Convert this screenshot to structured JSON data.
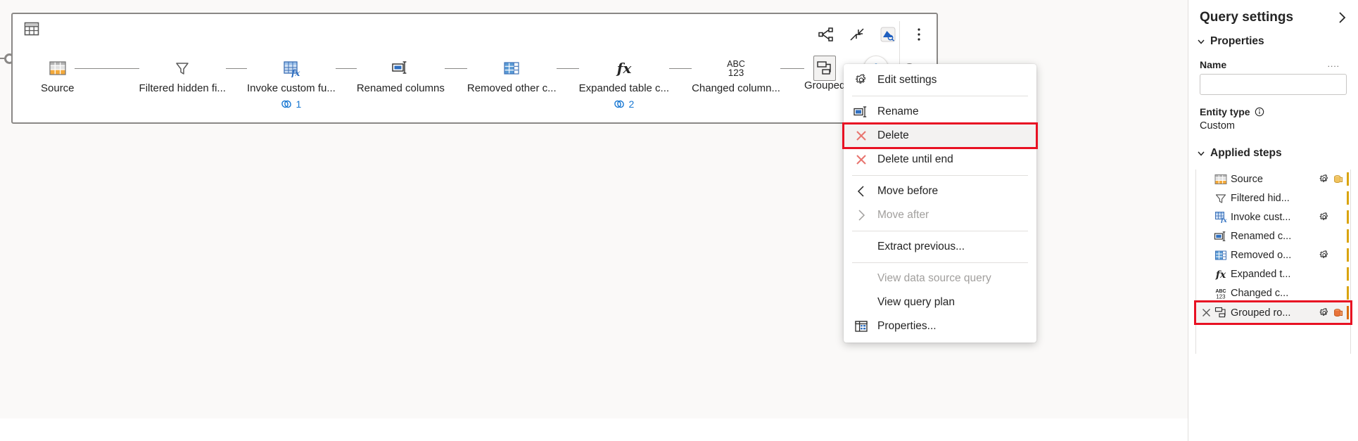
{
  "app": {
    "canvas_background": "#faf9f8",
    "accent_blue": "#1877d2",
    "highlight_red": "#e81123"
  },
  "diagram": {
    "query_icon_name": "table-icon",
    "toolbar": [
      {
        "name": "diagram-view-icon",
        "label": "Diagram view"
      },
      {
        "name": "collapse-icon",
        "label": "Collapse"
      },
      {
        "name": "query-data-icon",
        "label": "Query data"
      },
      {
        "name": "more-options-icon",
        "label": "More options"
      }
    ],
    "steps": [
      {
        "icon": "source-table-icon",
        "label": "Source",
        "badge": null,
        "selected": false
      },
      {
        "icon": "filter-funnel-icon",
        "label": "Filtered hidden fi...",
        "badge": null,
        "selected": false
      },
      {
        "icon": "invoke-function-icon",
        "label": "Invoke custom fu...",
        "badge": "1",
        "selected": false
      },
      {
        "icon": "rename-columns-icon",
        "label": "Renamed columns",
        "badge": null,
        "selected": false
      },
      {
        "icon": "removed-columns-icon",
        "label": "Removed other c...",
        "badge": null,
        "selected": false
      },
      {
        "icon": "fx-icon",
        "label": "Expanded table c...",
        "badge": "2",
        "selected": false
      },
      {
        "icon": "abc123-icon",
        "label": "Changed column...",
        "badge": null,
        "selected": false
      },
      {
        "icon": "group-rows-icon",
        "label": "Grouped",
        "badge": null,
        "selected": true
      }
    ],
    "add_step_label": "+",
    "badge_icon_name": "link-chain-icon"
  },
  "context_menu": {
    "items": [
      {
        "id": "edit-settings",
        "label": "Edit settings",
        "icon": "gear-icon",
        "disabled": false,
        "highlighted": false,
        "sep_after": true
      },
      {
        "id": "rename",
        "label": "Rename",
        "icon": "rename-icon",
        "disabled": false,
        "highlighted": false,
        "sep_after": false
      },
      {
        "id": "delete",
        "label": "Delete",
        "icon": "delete-x-icon",
        "disabled": false,
        "highlighted": true,
        "sep_after": false
      },
      {
        "id": "delete-until-end",
        "label": "Delete until end",
        "icon": "delete-x-icon",
        "disabled": false,
        "highlighted": false,
        "sep_after": true
      },
      {
        "id": "move-before",
        "label": "Move before",
        "icon": "chevron-left-icon",
        "disabled": false,
        "highlighted": false,
        "sep_after": false
      },
      {
        "id": "move-after",
        "label": "Move after",
        "icon": "chevron-right-icon",
        "disabled": true,
        "highlighted": false,
        "sep_after": true
      },
      {
        "id": "extract-previous",
        "label": "Extract previous...",
        "icon": "none",
        "disabled": false,
        "highlighted": false,
        "sep_after": true
      },
      {
        "id": "view-data-source-query",
        "label": "View data source query",
        "icon": "none",
        "disabled": true,
        "highlighted": false,
        "sep_after": false
      },
      {
        "id": "view-query-plan",
        "label": "View query plan",
        "icon": "none",
        "disabled": false,
        "highlighted": false,
        "sep_after": false
      },
      {
        "id": "properties",
        "label": "Properties...",
        "icon": "properties-icon",
        "disabled": false,
        "highlighted": false,
        "sep_after": false
      }
    ]
  },
  "query_settings": {
    "title": "Query settings",
    "collapse_icon": "chevron-right-icon",
    "properties": {
      "section_label": "Properties",
      "name_label": "Name",
      "name_value": "",
      "name_placeholder": "",
      "name_overflow": "....",
      "entity_type_label": "Entity type",
      "entity_type_info_icon": "info-icon",
      "entity_type_value": "Custom"
    },
    "applied_steps": {
      "section_label": "Applied steps",
      "items": [
        {
          "icon": "source-table-icon",
          "label": "Source",
          "gear": true,
          "db": true,
          "delete_x": false,
          "highlighted": false,
          "bar": "yellow"
        },
        {
          "icon": "filter-funnel-icon",
          "label": "Filtered hid...",
          "gear": false,
          "db": false,
          "delete_x": false,
          "highlighted": false,
          "bar": "yellow"
        },
        {
          "icon": "invoke-function-icon",
          "label": "Invoke cust...",
          "gear": true,
          "db": false,
          "delete_x": false,
          "highlighted": false,
          "bar": "yellow"
        },
        {
          "icon": "rename-columns-icon",
          "label": "Renamed c...",
          "gear": false,
          "db": false,
          "delete_x": false,
          "highlighted": false,
          "bar": "yellow"
        },
        {
          "icon": "removed-columns-icon",
          "label": "Removed o...",
          "gear": true,
          "db": false,
          "delete_x": false,
          "highlighted": false,
          "bar": "yellow"
        },
        {
          "icon": "fx-icon",
          "label": "Expanded t...",
          "gear": false,
          "db": false,
          "delete_x": false,
          "highlighted": false,
          "bar": "yellow"
        },
        {
          "icon": "abc123-icon",
          "label": "Changed c...",
          "gear": false,
          "db": false,
          "delete_x": false,
          "highlighted": false,
          "bar": "yellow"
        },
        {
          "icon": "group-rows-icon",
          "label": "Grouped ro...",
          "gear": true,
          "db": true,
          "delete_x": true,
          "highlighted": true,
          "bar": "orange"
        }
      ]
    }
  }
}
